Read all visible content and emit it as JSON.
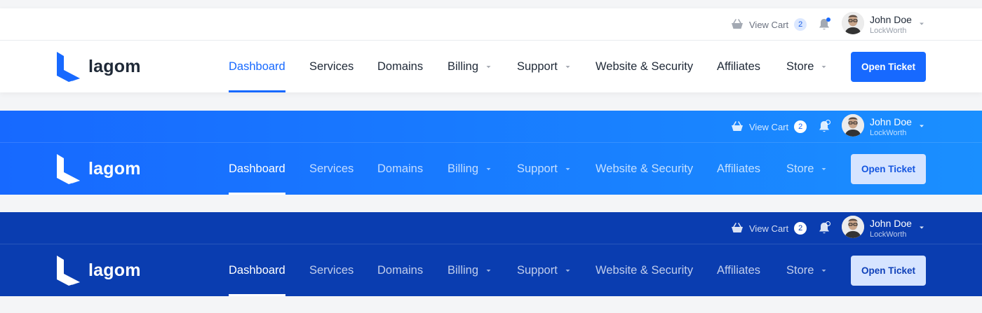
{
  "topbar": {
    "cart_label": "View Cart",
    "cart_count": "2",
    "user_name": "John Doe",
    "user_company": "LockWorth"
  },
  "brand": {
    "name": "lagom"
  },
  "nav": {
    "items": [
      {
        "label": "Dashboard",
        "dropdown": false,
        "active": true
      },
      {
        "label": "Services",
        "dropdown": false
      },
      {
        "label": "Domains",
        "dropdown": false
      },
      {
        "label": "Billing",
        "dropdown": true
      },
      {
        "label": "Support",
        "dropdown": true
      },
      {
        "label": "Website & Security",
        "dropdown": false
      },
      {
        "label": "Affiliates",
        "dropdown": false
      },
      {
        "label": "Store",
        "dropdown": true
      }
    ],
    "cta_label": "Open Ticket"
  },
  "variants": [
    {
      "name": "light",
      "background": "#ffffff",
      "accent": "#1769ff"
    },
    {
      "name": "bright-blue",
      "background": "#1a7fff",
      "accent": "#ffffff"
    },
    {
      "name": "dark-blue",
      "background": "#0a3db0",
      "accent": "#ffffff"
    }
  ],
  "icons": {
    "cart": "basket-icon",
    "notifications": "bell-icon",
    "dropdown": "caret-down-icon"
  }
}
